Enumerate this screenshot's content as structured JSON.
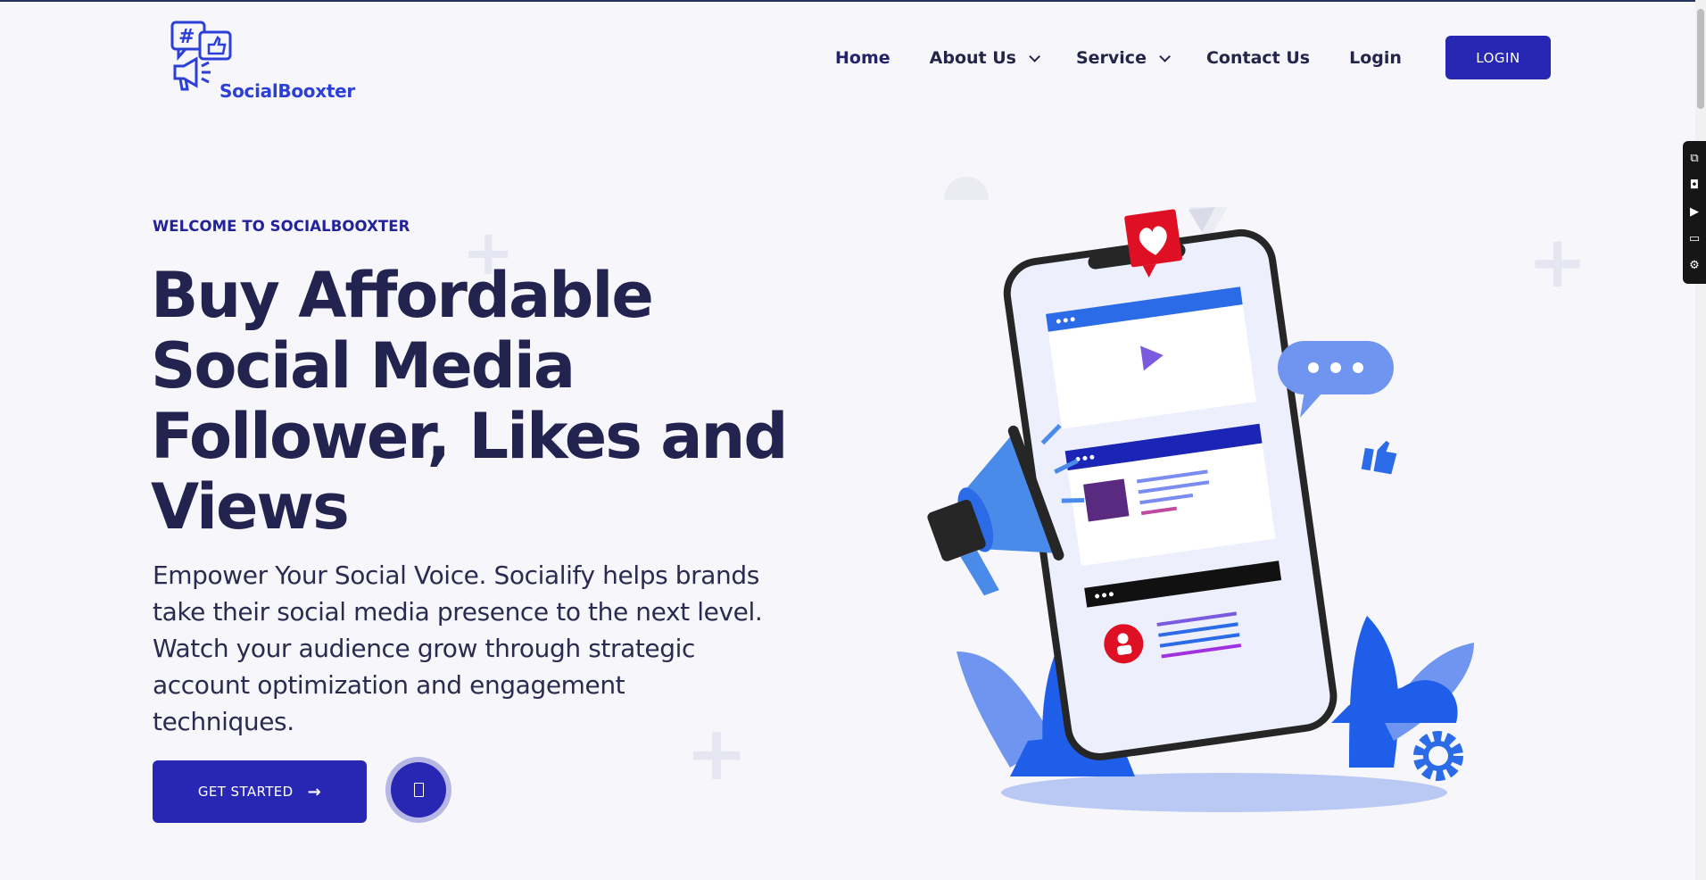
{
  "brand": {
    "name": "SocialBooxter",
    "accent": "#2727b3",
    "logo_color": "#2c3fd6"
  },
  "nav": {
    "items": [
      {
        "label": "Home",
        "active": true,
        "dropdown": false
      },
      {
        "label": "About Us",
        "active": false,
        "dropdown": true
      },
      {
        "label": "Service",
        "active": false,
        "dropdown": true
      },
      {
        "label": "Contact Us",
        "active": false,
        "dropdown": false
      },
      {
        "label": "Login",
        "active": false,
        "dropdown": false
      }
    ],
    "login_button": "LOGIN"
  },
  "hero": {
    "eyebrow": "WELCOME TO SOCIALBOOXTER",
    "headline_lines": [
      "Buy Affordable",
      "Social Media",
      "Follower, Likes and",
      "Views"
    ],
    "description": "Empower Your Social Voice. Socialify helps brands take their social media presence to the next level. Watch your audience grow through strategic account optimization and engagement techniques.",
    "cta_label": "GET STARTED",
    "cta_icon": "arrow-right-icon",
    "play_icon": "video-play-icon"
  },
  "side_toolbar": {
    "icons": [
      "extension-icon",
      "camera-icon",
      "video-icon",
      "window-icon",
      "settings-icon"
    ]
  }
}
